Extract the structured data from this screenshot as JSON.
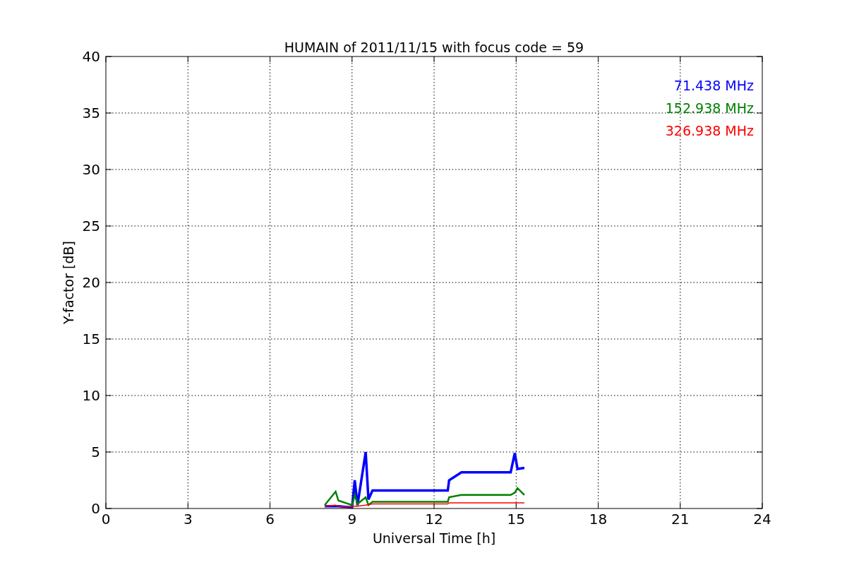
{
  "figure": {
    "chart_data": {
      "type": "line",
      "title": "HUMAIN of 2011/11/15 with focus code = 59",
      "xlabel": "Universal Time [h]",
      "ylabel": "Y-factor [dB]",
      "x": [
        8.0,
        8.4,
        8.5,
        9.0,
        9.1,
        9.2,
        9.5,
        9.6,
        9.75,
        12.5,
        12.55,
        13.0,
        14.8,
        14.95,
        15.05,
        15.3
      ],
      "series": [
        {
          "name": "71.438 MHz",
          "color": "#0000ff",
          "values": [
            0.2,
            0.2,
            0.2,
            0.1,
            2.5,
            0.3,
            5.0,
            0.8,
            1.6,
            1.6,
            2.5,
            3.2,
            3.2,
            4.9,
            3.5,
            3.6
          ]
        },
        {
          "name": "152.938 MHz",
          "color": "#008000",
          "values": [
            0.3,
            1.5,
            0.7,
            0.3,
            1.2,
            0.4,
            1.0,
            0.3,
            0.6,
            0.6,
            1.0,
            1.2,
            1.2,
            1.4,
            1.8,
            1.2
          ]
        },
        {
          "name": "326.938 MHz",
          "color": "#ff0000",
          "values": [
            0.2,
            0.3,
            0.2,
            0.15,
            0.2,
            0.2,
            0.3,
            0.35,
            0.4,
            0.4,
            0.5,
            0.5,
            0.5,
            0.5,
            0.5,
            0.5
          ]
        }
      ],
      "xlim": [
        0,
        24
      ],
      "ylim": [
        0,
        40
      ],
      "xticks": [
        0,
        3,
        6,
        9,
        12,
        15,
        18,
        21,
        24
      ],
      "yticks": [
        0,
        5,
        10,
        15,
        20,
        25,
        30,
        35,
        40
      ],
      "grid": true
    }
  }
}
